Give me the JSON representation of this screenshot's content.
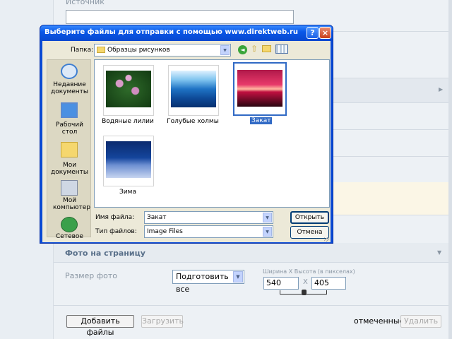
{
  "web": {
    "source_label": "Источник",
    "photo_section_title": "Фото на страницу",
    "photo_size_label": "Размер фото",
    "photo_size_select": "Подготовить все",
    "dimensions_label": "Ширина X Высота (в пикселах)",
    "width": "540",
    "times": "X",
    "height": "405",
    "add_files": "Добавить файлы",
    "upload": "Загрузить",
    "marked_label": "отмеченные:",
    "delete": "Удалить"
  },
  "dialog": {
    "title": "Выберите файлы для отправки с помощью www.direktweb.ru",
    "folder_label": "Папка:",
    "folder_value": "Образцы рисунков",
    "places": [
      "Недавние документы",
      "Рабочий стол",
      "Мои документы",
      "Мой компьютер",
      "Сетевое"
    ],
    "files": [
      "Водяные лилии",
      "Голубые холмы",
      "Закат",
      "Зима"
    ],
    "filename_label": "Имя файла:",
    "filename_value": "Закат",
    "filetype_label": "Тип файлов:",
    "filetype_value": "Image Files",
    "open_button": "Открыть",
    "cancel_button": "Отмена",
    "help_glyph": "?",
    "close_glyph": "×"
  },
  "colors": {
    "titlebar": "#0a58e8",
    "selection": "#316ac5",
    "dialog_face": "#ece9d8"
  }
}
